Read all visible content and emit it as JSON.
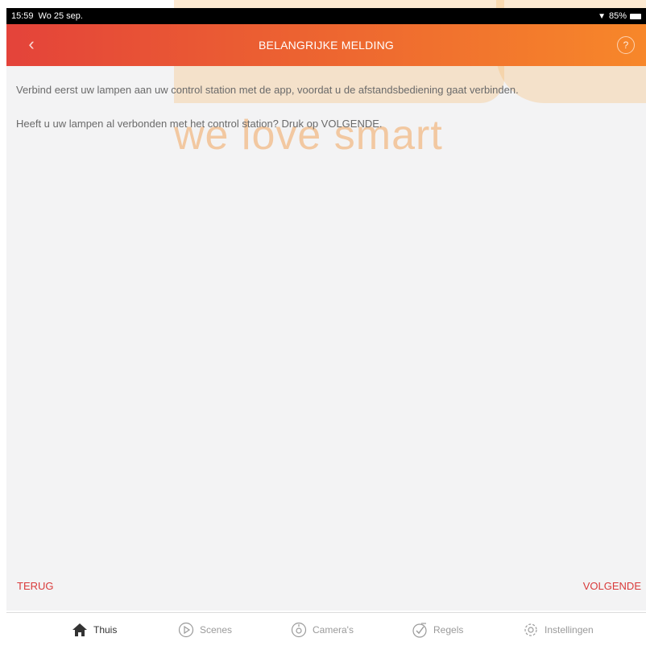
{
  "status_bar": {
    "time": "15:59",
    "date": "Wo 25 sep.",
    "battery": "85%"
  },
  "nav": {
    "title": "BELANGRIJKE MELDING",
    "back_icon": "chevron-left-icon",
    "help_icon": "question-circle-icon",
    "help_glyph": "?"
  },
  "watermark": {
    "text": "we love smart"
  },
  "content": {
    "message_1": "Verbind eerst uw lampen aan uw control station met de app, voordat u de afstandsbediening gaat verbinden.",
    "message_2": "Heeft u uw lampen al verbonden met het control station? Druk op VOLGENDE."
  },
  "actions": {
    "back_label": "TERUG",
    "next_label": "VOLGENDE"
  },
  "tabs": [
    {
      "label": "Thuis",
      "icon": "home-icon",
      "active": true
    },
    {
      "label": "Scenes",
      "icon": "play-circle-icon",
      "active": false
    },
    {
      "label": "Camera's",
      "icon": "camera-icon",
      "active": false
    },
    {
      "label": "Regels",
      "icon": "check-circle-icon",
      "active": false
    },
    {
      "label": "Instellingen",
      "icon": "gear-icon",
      "active": false
    }
  ],
  "colors": {
    "accent_red": "#d93a3a",
    "nav_gradient_start": "#e4433a",
    "nav_gradient_end": "#f7872a"
  }
}
